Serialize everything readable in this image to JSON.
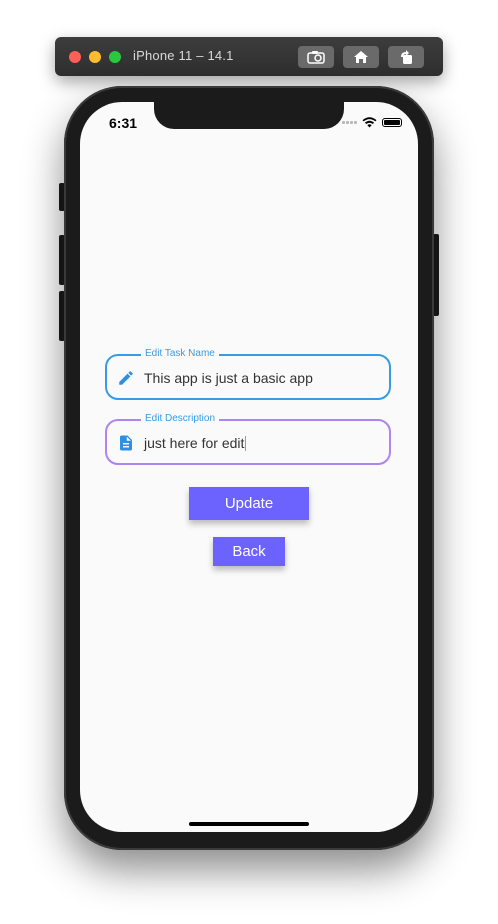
{
  "simulator": {
    "title": "iPhone 11 – 14.1",
    "buttons": [
      "screenshot-icon",
      "home-icon",
      "rotate-icon"
    ]
  },
  "status_bar": {
    "time": "6:31",
    "icons": [
      "signal-dots-icon",
      "wifi-icon",
      "battery-icon"
    ]
  },
  "form": {
    "task_name": {
      "label": "Edit Task Name",
      "value": "This app is just a basic app",
      "icon": "pencil-icon",
      "border_color": "#3a9be2"
    },
    "description": {
      "label": "Edit Description",
      "value": "just here for edit",
      "icon": "document-icon",
      "border_color": "#ae84ef"
    }
  },
  "buttons": {
    "update_label": "Update",
    "back_label": "Back"
  },
  "colors": {
    "accent": "#6c63ff",
    "label": "#3a9be2",
    "icon": "#2f8fe0"
  }
}
